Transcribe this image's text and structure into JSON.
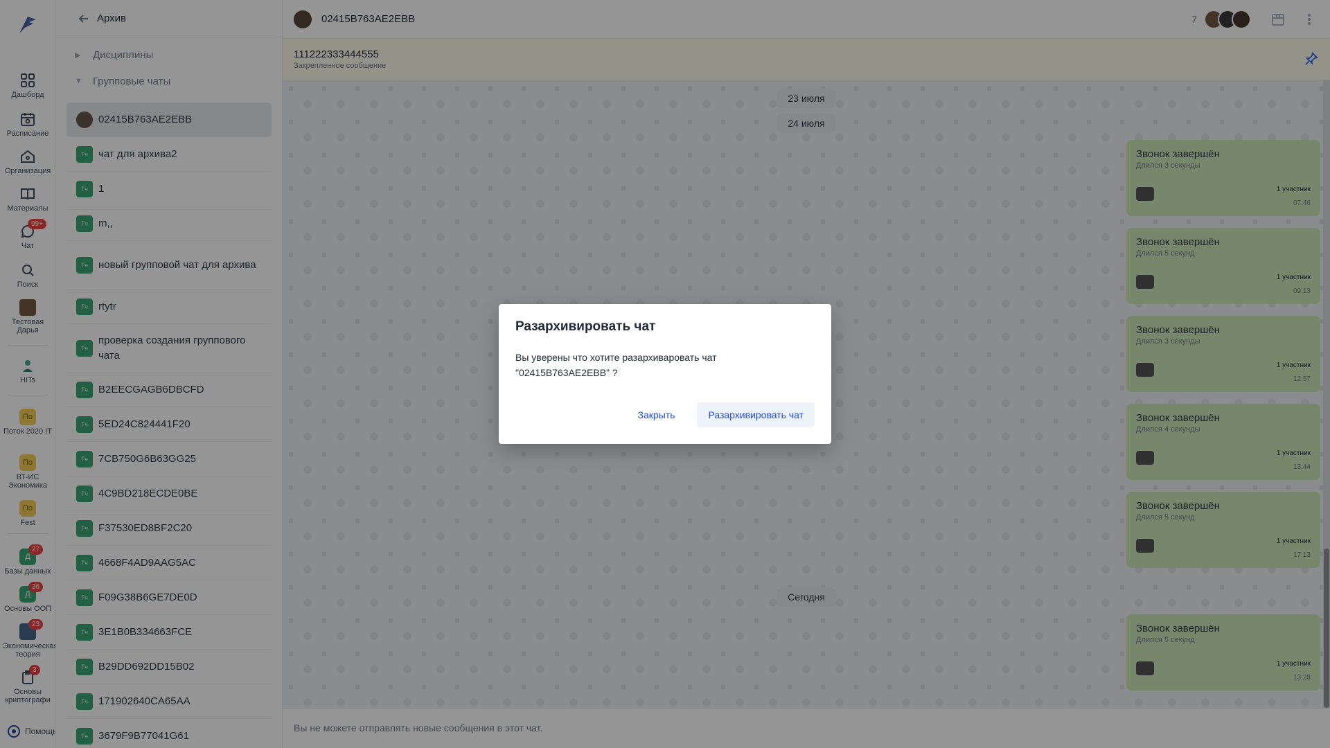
{
  "rail": {
    "items": [
      {
        "label": "Дашборд",
        "icon": "dashboard-icon"
      },
      {
        "label": "Расписание",
        "icon": "calendar-icon"
      },
      {
        "label": "Организация",
        "icon": "home-icon"
      },
      {
        "label": "Материалы",
        "icon": "book-icon"
      },
      {
        "label": "Чат",
        "icon": "chat-icon",
        "badge": "99+"
      },
      {
        "label": "Поиск",
        "icon": "search-icon"
      },
      {
        "label": "Тестовая Дарья",
        "icon": "avatar"
      },
      {
        "label": "HITs",
        "icon": "hits-icon"
      },
      {
        "label": "Поток 2020 IT",
        "square": "По"
      },
      {
        "label": "ВТ-ИС Экономика",
        "square": "По"
      },
      {
        "label": "Fest",
        "square": "По"
      },
      {
        "label": "Базы данных",
        "square": "Д",
        "badge": "27"
      },
      {
        "label": "Основы ООП",
        "square": "Д",
        "badge": "36"
      },
      {
        "label": "Экономическая теория",
        "badge": "23"
      },
      {
        "label": "Основы криптографи",
        "badge": "3"
      }
    ],
    "help": "Помощь"
  },
  "panel": {
    "title": "Архив",
    "folders": [
      "Дисциплины",
      "Групповые чаты"
    ],
    "avatar_label": "Гч",
    "chats": [
      "02415B763AE2EBB",
      "чат для архива2",
      "1",
      "m,,",
      "новый групповой чат для архива",
      "rtytr",
      "проверка создания группового чата",
      "B2EECGAGB6DBCFD",
      "5ED24C824441F20",
      "7CB750G6B63GG25",
      "4C9BD218ECDE0BE",
      "F37530ED8BF2C20",
      "4668F4AD9AAG5AC",
      "F09G38B6GE7DE0D",
      "3E1B0B334663FCE",
      "B29DD692DD15B02",
      "171902640CA65AA",
      "3679F9B77041G61"
    ]
  },
  "topbar": {
    "title": "02415B763AE2EBB",
    "member_count": "7"
  },
  "pinned": {
    "text": "111222333444555",
    "label": "Закрепленное сообщение"
  },
  "dates": [
    "23 июля",
    "24 июля",
    "Сегодня"
  ],
  "calls": [
    {
      "title": "Звонок завершён",
      "duration": "Длился 3 секунды",
      "participants": "1 участник",
      "time": "07:46"
    },
    {
      "title": "Звонок завершён",
      "duration": "Длился 5 секунд",
      "participants": "1 участник",
      "time": "09:13"
    },
    {
      "title": "Звонок завершён",
      "duration": "Длился 3 секунды",
      "participants": "1 участник",
      "time": "12:57"
    },
    {
      "title": "Звонок завершён",
      "duration": "Длился 4 секунды",
      "participants": "1 участник",
      "time": "13:44"
    },
    {
      "title": "Звонок завершён",
      "duration": "Длился 5 секунд",
      "participants": "1 участник",
      "time": "17:13"
    },
    {
      "title": "Звонок завершён",
      "duration": "Длился 5 секунд",
      "participants": "1 участник",
      "time": "13:28"
    }
  ],
  "composer": {
    "text": "Вы не можете отправлять новые сообщения в этот чат."
  },
  "modal": {
    "title": "Разархивировать чат",
    "body_line1": "Вы уверены что хотите разархиваровать чат",
    "body_line2": "\"02415B763AE2EBB\" ?",
    "close_label": "Закрыть",
    "confirm_label": "Разархивировать чат"
  },
  "colors": {
    "accent": "#1d4ed8",
    "call_bubble": "#c9e6b4",
    "chat_avatar": "#2e9e6b",
    "badge": "#e53935"
  }
}
